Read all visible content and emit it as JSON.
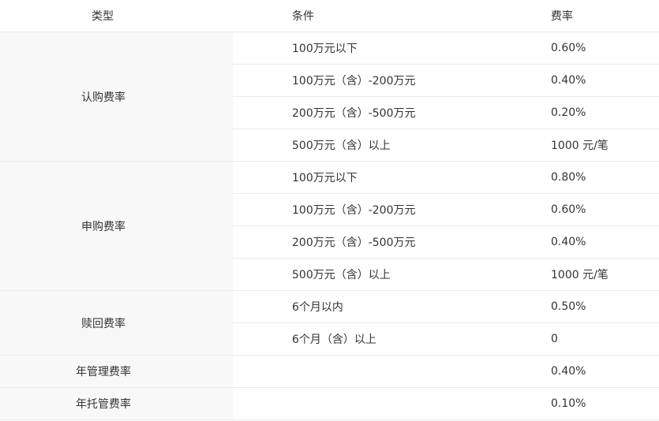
{
  "table": {
    "headers": {
      "type": "类型",
      "condition": "条件",
      "rate": "费率"
    },
    "groups": [
      {
        "type": "认购费率",
        "rows": [
          {
            "condition": "100万元以下",
            "rate": "0.60%"
          },
          {
            "condition": "100万元（含）-200万元",
            "rate": "0.40%"
          },
          {
            "condition": "200万元（含）-500万元",
            "rate": "0.20%"
          },
          {
            "condition": "500万元（含）以上",
            "rate": "1000 元/笔"
          }
        ]
      },
      {
        "type": "申购费率",
        "rows": [
          {
            "condition": "100万元以下",
            "rate": "0.80%"
          },
          {
            "condition": "100万元（含）-200万元",
            "rate": "0.60%"
          },
          {
            "condition": "200万元（含）-500万元",
            "rate": "0.40%"
          },
          {
            "condition": "500万元（含）以上",
            "rate": "1000 元/笔"
          }
        ]
      },
      {
        "type": "赎回费率",
        "rows": [
          {
            "condition": "6个月以内",
            "rate": "0.50%"
          },
          {
            "condition": "6个月（含）以上",
            "rate": "0"
          }
        ]
      },
      {
        "type": "年管理费率",
        "rows": [
          {
            "condition": "",
            "rate": "0.40%"
          }
        ]
      },
      {
        "type": "年托管费率",
        "rows": [
          {
            "condition": "",
            "rate": "0.10%"
          }
        ]
      }
    ]
  }
}
